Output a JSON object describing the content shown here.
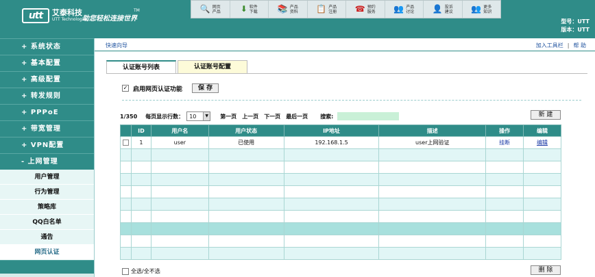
{
  "header": {
    "brand_cn": "艾泰科技",
    "brand_en": "UTT Technologies",
    "logo_text": "utt",
    "slogan": "助您轻松连接世界",
    "tm": "TM",
    "model_line": "型号：UTT",
    "version_line": "版本：UTT"
  },
  "top_menu": [
    {
      "label1": "网页",
      "label2": "产品",
      "icon": "search-icon",
      "glyph": "🔍"
    },
    {
      "label1": "软件",
      "label2": "下载",
      "icon": "download-icon",
      "glyph": "⬇"
    },
    {
      "label1": "产品",
      "label2": "资料",
      "icon": "book-icon",
      "glyph": "📚"
    },
    {
      "label1": "产品",
      "label2": "注册",
      "icon": "register-icon",
      "glyph": "📋"
    },
    {
      "label1": "预约",
      "label2": "服务",
      "icon": "phone-icon",
      "glyph": "☎"
    },
    {
      "label1": "产品",
      "label2": "讨论",
      "icon": "forum-icon",
      "glyph": "👥"
    },
    {
      "label1": "投诉",
      "label2": "建议",
      "icon": "feedback-icon",
      "glyph": "👤"
    },
    {
      "label1": "更多",
      "label2": "知识",
      "icon": "knowledge-icon",
      "glyph": "👥"
    }
  ],
  "sidebar": {
    "menu": [
      {
        "label": "+ 系统状态"
      },
      {
        "label": "+ 基本配置"
      },
      {
        "label": "+ 高级配置"
      },
      {
        "label": "+ 转发规则"
      },
      {
        "label": "+ PPPoE"
      },
      {
        "label": "+ 带宽管理"
      },
      {
        "label": "+ VPN配置"
      },
      {
        "label": "- 上网管理"
      }
    ],
    "sub": [
      {
        "label": "用户管理"
      },
      {
        "label": "行为管理"
      },
      {
        "label": "策略库"
      },
      {
        "label": "QQ白名单"
      },
      {
        "label": "通告"
      },
      {
        "label": "网页认证"
      }
    ]
  },
  "toolbar": {
    "quick": "快速向导",
    "add_toolbar": "加入工具栏",
    "sep": "|",
    "help": "帮 助"
  },
  "tabs": {
    "list": "认证账号列表",
    "config": "认证账号配置"
  },
  "form": {
    "enable_label": "启用网页认证功能",
    "enable_checked": "✓",
    "save": "保 存"
  },
  "pager": {
    "count": "1/350",
    "per_page_label": "每页显示行数：",
    "per_page": "10",
    "first": "第一页",
    "prev": "上一页",
    "next": "下一页",
    "last": "最后一页",
    "search_label": "搜索:",
    "new": "新 建"
  },
  "table": {
    "headers": [
      "",
      "ID",
      "用户名",
      "用户状态",
      "IP地址",
      "描述",
      "操作",
      "编辑"
    ],
    "rows": [
      {
        "id": "1",
        "user": "user",
        "status": "已使用",
        "ip": "192.168.1.5",
        "desc": "user上网验证",
        "op": "挂断",
        "edit": "编辑"
      }
    ]
  },
  "footer": {
    "select_all": "全选/全不选",
    "delete": "删 除"
  }
}
